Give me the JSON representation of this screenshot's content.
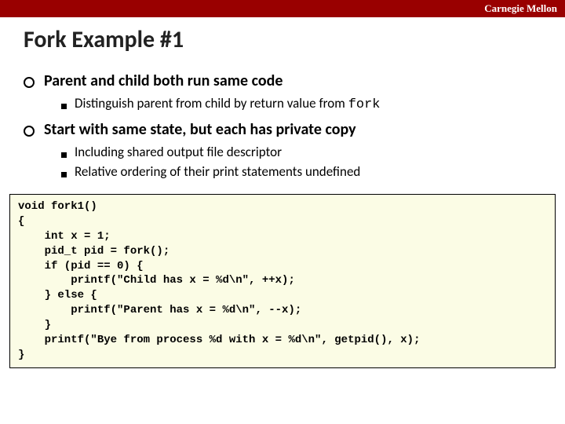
{
  "banner": {
    "org": "Carnegie Mellon"
  },
  "title": "Fork Example #1",
  "bullets": [
    {
      "text": "Parent and child both run same code",
      "sub": [
        {
          "prefix": "Distinguish parent from child by return value from ",
          "mono": "fork"
        }
      ]
    },
    {
      "text": "Start with same state, but each has private copy",
      "sub": [
        {
          "text": "Including shared output file descriptor"
        },
        {
          "text": "Relative ordering of their print statements undefined"
        }
      ]
    }
  ],
  "code": "void fork1()\n{\n    int x = 1;\n    pid_t pid = fork();\n    if (pid == 0) {\n        printf(\"Child has x = %d\\n\", ++x);\n    } else {\n        printf(\"Parent has x = %d\\n\", --x);\n    }\n    printf(\"Bye from process %d with x = %d\\n\", getpid(), x);\n}"
}
